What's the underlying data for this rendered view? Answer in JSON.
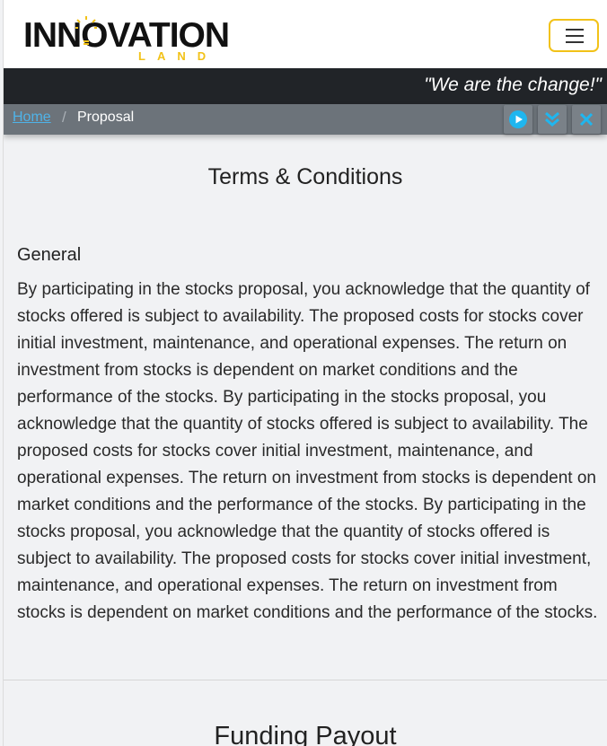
{
  "header": {
    "logo_main": "INNOVATION",
    "logo_sub": "LAND",
    "accent_color": "#f2c218",
    "menu_icon": "hamburger-menu-icon"
  },
  "tagline": "\"We are the change!\"",
  "breadcrumb": {
    "home": "Home",
    "separator": "/",
    "current": "Proposal"
  },
  "toolbar": {
    "play_icon": "play-icon",
    "scroll_icon": "double-chevron-down-icon",
    "close_icon": "close-icon"
  },
  "main": {
    "title": "Terms & Conditions",
    "section_heading": "General",
    "paragraph": "By participating in the stocks proposal, you acknowledge that the quantity of stocks offered is subject to availability. The proposed costs for stocks cover initial investment, maintenance, and operational expenses. The return on investment from stocks is dependent on market conditions and the performance of the stocks. By participating in the stocks proposal, you acknowledge that the quantity of stocks offered is subject to availability. The proposed costs for stocks cover initial investment, maintenance, and operational expenses. The return on investment from stocks is dependent on market conditions and the performance of the stocks. By participating in the stocks proposal, you acknowledge that the quantity of stocks offered is subject to availability. The proposed costs for stocks cover initial investment, maintenance, and operational expenses. The return on investment from stocks is dependent on market conditions and the performance of the stocks.",
    "next_title": "Funding Payout"
  }
}
